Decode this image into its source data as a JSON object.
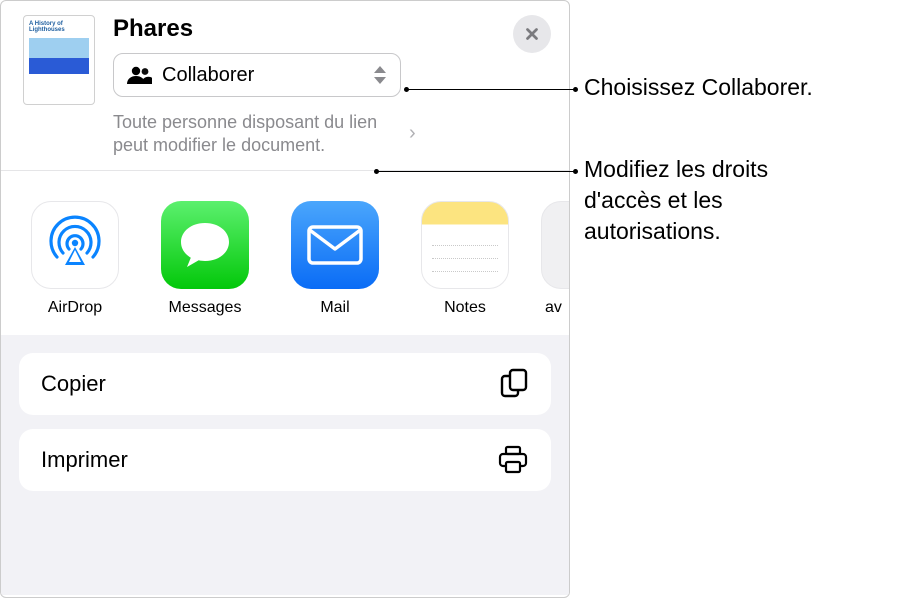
{
  "thumbnail": {
    "title_line": "A History of Lighthouses"
  },
  "sheet": {
    "title": "Phares",
    "collaborate": {
      "label": "Collaborer"
    },
    "permission": {
      "text": "Toute personne disposant du lien peut modifier le document."
    }
  },
  "apps": [
    {
      "id": "airdrop",
      "label": "AirDrop"
    },
    {
      "id": "messages",
      "label": "Messages"
    },
    {
      "id": "mail",
      "label": "Mail"
    },
    {
      "id": "notes",
      "label": "Notes"
    }
  ],
  "apps_partial_label": "av",
  "actions": {
    "copy": {
      "label": "Copier"
    },
    "print": {
      "label": "Imprimer"
    }
  },
  "annotations": {
    "choose": "Choisissez Collaborer.",
    "modify": "Modifiez les droits d'accès et les autorisations."
  },
  "colors": {
    "secondary_text": "#8a8a8e",
    "actions_bg": "#f2f2f6"
  }
}
